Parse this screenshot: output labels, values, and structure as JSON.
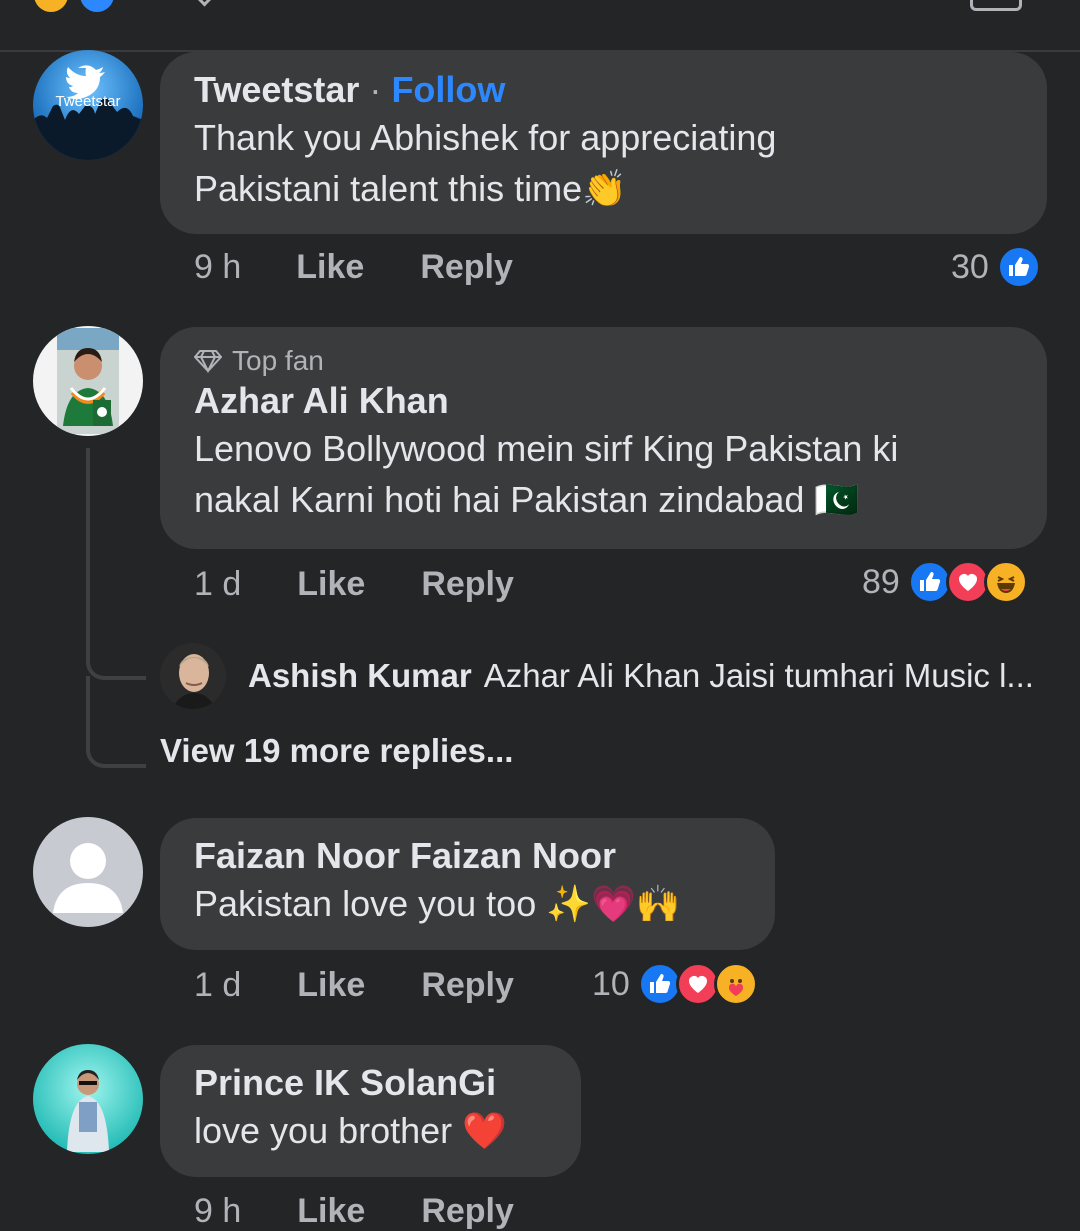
{
  "comments": [
    {
      "name": "Tweetstar",
      "follow_sep": "·",
      "follow_label": "Follow",
      "text_line1": "Thank you Abhishek for appreciating",
      "text_line2": "Pakistani talent this time👏",
      "avatar_text": "Tweetstar",
      "time": "9 h",
      "like_label": "Like",
      "reply_label": "Reply",
      "reaction_count": "30",
      "reactions": [
        "like-icon"
      ]
    },
    {
      "badge": "Top fan",
      "name": "Azhar Ali Khan",
      "text_line1": "Lenovo Bollywood mein sirf King Pakistan ki",
      "text_line2": "nakal Karni hoti hai Pakistan zindabad 🇵🇰",
      "time": "1 d",
      "like_label": "Like",
      "reply_label": "Reply",
      "reaction_count": "89",
      "reactions": [
        "like-icon",
        "love-icon",
        "haha-icon"
      ],
      "reply_preview": {
        "name": "Ashish Kumar",
        "text": "Azhar Ali Khan Jaisi tumhari Music l..."
      },
      "view_more": "View 19 more replies..."
    },
    {
      "name": "Faizan Noor Faizan Noor",
      "text_line1": "Pakistan love you too ✨💗🙌",
      "time": "1 d",
      "like_label": "Like",
      "reply_label": "Reply",
      "reaction_count": "10",
      "reactions": [
        "like-icon",
        "love-icon",
        "care-icon"
      ]
    },
    {
      "name": "Prince IK SolanGi",
      "text_line1": "love you brother ❤️",
      "time": "9 h",
      "like_label": "Like",
      "reply_label": "Reply"
    }
  ],
  "colors": {
    "background": "#242526",
    "bubble": "#3a3b3c",
    "link": "#2d88ff",
    "like": "#1877f2",
    "love": "#f33e58",
    "haha": "#f7b125"
  }
}
